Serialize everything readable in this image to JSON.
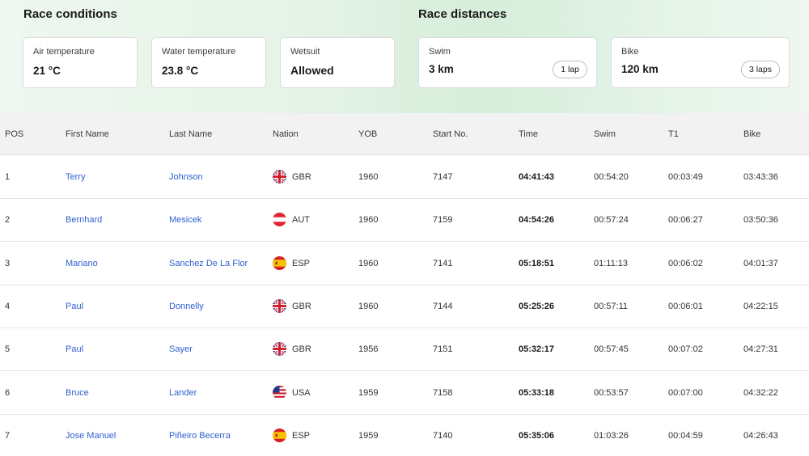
{
  "conditions": {
    "title": "Race conditions",
    "cards": [
      {
        "label": "Air temperature",
        "value": "21 °C"
      },
      {
        "label": "Water temperature",
        "value": "23.8 °C"
      },
      {
        "label": "Wetsuit",
        "value": "Allowed"
      }
    ]
  },
  "distances": {
    "title": "Race distances",
    "cards": [
      {
        "label": "Swim",
        "value": "3 km",
        "laps": "1 lap"
      },
      {
        "label": "Bike",
        "value": "120 km",
        "laps": "3 laps"
      }
    ]
  },
  "table": {
    "headers": [
      "POS",
      "First Name",
      "Last Name",
      "Nation",
      "YOB",
      "Start No.",
      "Time",
      "Swim",
      "T1",
      "Bike"
    ],
    "rows": [
      {
        "pos": "1",
        "first": "Terry",
        "last": "Johnson",
        "flag": "gbr-flag-icon",
        "nation": "GBR",
        "yob": "1960",
        "start": "7147",
        "time": "04:41:43",
        "swim": "00:54:20",
        "t1": "00:03:49",
        "bike": "03:43:36"
      },
      {
        "pos": "2",
        "first": "Bernhard",
        "last": "Mesicek",
        "flag": "aut-flag-icon",
        "nation": "AUT",
        "yob": "1960",
        "start": "7159",
        "time": "04:54:26",
        "swim": "00:57:24",
        "t1": "00:06:27",
        "bike": "03:50:36"
      },
      {
        "pos": "3",
        "first": "Mariano",
        "last": "Sanchez De La Flor",
        "flag": "esp-flag-icon",
        "nation": "ESP",
        "yob": "1960",
        "start": "7141",
        "time": "05:18:51",
        "swim": "01:11:13",
        "t1": "00:06:02",
        "bike": "04:01:37"
      },
      {
        "pos": "4",
        "first": "Paul",
        "last": "Donnelly",
        "flag": "gbr-flag-icon",
        "nation": "GBR",
        "yob": "1960",
        "start": "7144",
        "time": "05:25:26",
        "swim": "00:57:11",
        "t1": "00:06:01",
        "bike": "04:22:15"
      },
      {
        "pos": "5",
        "first": "Paul",
        "last": "Sayer",
        "flag": "gbr-flag-icon",
        "nation": "GBR",
        "yob": "1956",
        "start": "7151",
        "time": "05:32:17",
        "swim": "00:57:45",
        "t1": "00:07:02",
        "bike": "04:27:31"
      },
      {
        "pos": "6",
        "first": "Bruce",
        "last": "Lander",
        "flag": "usa-flag-icon",
        "nation": "USA",
        "yob": "1959",
        "start": "7158",
        "time": "05:33:18",
        "swim": "00:53:57",
        "t1": "00:07:00",
        "bike": "04:32:22"
      },
      {
        "pos": "7",
        "first": "Jose Manuel",
        "last": "Piñeiro Becerra",
        "flag": "esp-flag-icon",
        "nation": "ESP",
        "yob": "1959",
        "start": "7140",
        "time": "05:35:06",
        "swim": "01:03:26",
        "t1": "00:04:59",
        "bike": "04:26:43"
      }
    ]
  },
  "colors": {
    "link": "#2f5fd0",
    "header_bg": "#f2f2f2",
    "hero_green": "#d7eedb"
  }
}
